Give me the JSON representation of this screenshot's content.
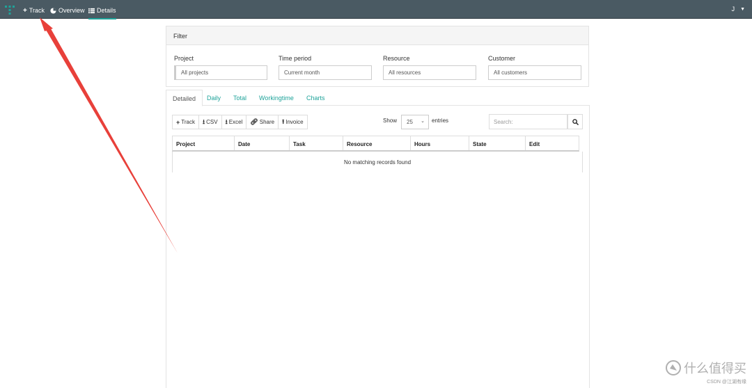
{
  "nav": {
    "track": "Track",
    "overview": "Overview",
    "details": "Details",
    "user": "J"
  },
  "filter": {
    "title": "Filter",
    "project_label": "Project",
    "project_value": "All projects",
    "time_label": "Time period",
    "time_value": "Current month",
    "resource_label": "Resource",
    "resource_value": "All resources",
    "customer_label": "Customer",
    "customer_value": "All customers"
  },
  "tabs": [
    "Detailed",
    "Daily",
    "Total",
    "Workingtime",
    "Charts"
  ],
  "toolbar": {
    "track": "Track",
    "csv": "CSV",
    "excel": "Excel",
    "share": "Share",
    "invoice": "Invoice",
    "show": "Show",
    "page_length": "25",
    "entries": "entries",
    "search_placeholder": "Search:"
  },
  "table": {
    "columns": [
      "Project",
      "Date",
      "Task",
      "Resource",
      "Hours",
      "State",
      "Edit"
    ],
    "empty_message": "No matching records found"
  },
  "watermark": {
    "logo_text": "什么值得买",
    "small_text": "CSDN @江湖有缘"
  },
  "colors": {
    "navbar": "#4a5a63",
    "accent": "#1fa39a",
    "annotation": "#e8403a"
  }
}
